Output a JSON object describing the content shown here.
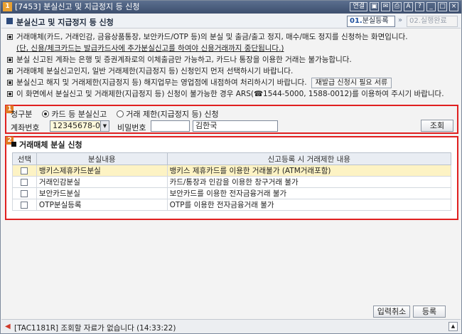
{
  "window": {
    "number": "1",
    "title": "[7453] 분실신고 및 지급정지 등 신청",
    "link_label": "연결",
    "tool_icons": [
      "lock-icon",
      "mail-icon",
      "print-icon",
      "font-up-icon",
      "help-icon",
      "minimize-icon",
      "maximize-icon",
      "close-icon"
    ]
  },
  "header": {
    "title": "분실신고 및 지급정지 등 신청",
    "step1": {
      "num": "01.",
      "label": "분실등록"
    },
    "step_sep": "»",
    "step2": {
      "num": "02.",
      "label": "실행완료"
    }
  },
  "notices": [
    "거래매체(카드, 거래인감, 금융상품통장, 보안카드/OTP 등)의 분실 및 출금/출고 정지, 매수/매도 정지를 신청하는 화면입니다.",
    "(단, 신용/체크카드는 발급카드사에 추가분실신고를 하여야 신용거래까지 중단됩니다.)",
    "분실 신고된 계좌는 은행 및 증권계좌로의 이체출금만 가능하고, 카드나 통장을 이용한 거래는 불가능합니다.",
    "거래매체 분실신고인지, 일반 거래제한(지급정지 등) 신청인지 먼저 선택하시기 바랍니다.",
    "분실신고 해지 및 거래제한(지급정지 등) 해지업무는 영업점에 내점하여 처리하시기 바랍니다.",
    "이 화면에서 분실신고 및 거래제한(지급정지 등) 신청이 불가능한 경우 ARS(☎1544-5000, 1588-0012)를 이용하여 주시기 바랍니다."
  ],
  "reissue_button": "재발급 신청시 필요 서류",
  "section1": {
    "badge": "1",
    "request_label": "청구분",
    "option_card": "카드 등 분실신고",
    "option_limit": "거래 제한(지급정지 등) 신청",
    "selected": "option_card",
    "account_label": "계좌번호",
    "account_value": "12345678-01",
    "password_label": "비밀번호",
    "password_value": "",
    "name_value": "김한국",
    "search_button": "조회"
  },
  "section2": {
    "badge": "2",
    "title": "거래매체 분실 신청",
    "columns": [
      "선택",
      "분실내용",
      "신고등록 시 거래제한 내용"
    ],
    "rows": [
      {
        "item": "뱅키스제휴카드분실",
        "restriction": "뱅키스 제휴카드를 이용한 거래불가 (ATM거래포함)",
        "checked": false,
        "selected": true
      },
      {
        "item": "거래인감분실",
        "restriction": "카드/통장과 인감을 이용한 창구거래 불가",
        "checked": false,
        "selected": false
      },
      {
        "item": "보안카드분실",
        "restriction": "보안카드를 이용한 전자금융거래 불가",
        "checked": false,
        "selected": false
      },
      {
        "item": "OTP분실등록",
        "restriction": "OTP를 이용한 전자금융거래 불가",
        "checked": false,
        "selected": false
      }
    ]
  },
  "buttons": {
    "reset": "입력취소",
    "register": "등록"
  },
  "status": {
    "message": "[TAC1181R] 조회할 자료가 없습니다 (14:33:22)"
  }
}
